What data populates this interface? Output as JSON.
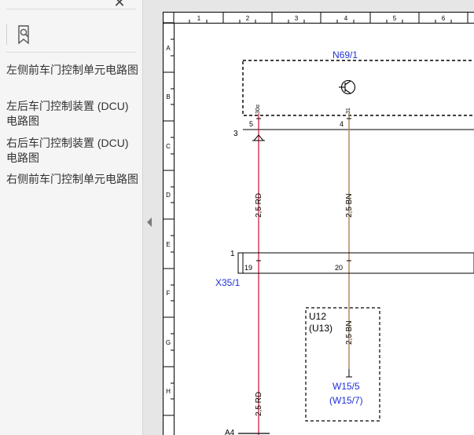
{
  "sidebar": {
    "close_glyph": "✕",
    "bookmark_icon": "bookmark-search-icon",
    "bookmarks": [
      {
        "label": "左侧前车门控制单元电路图"
      },
      {
        "label": "左后车门控制装置 (DCU) 电路图"
      },
      {
        "label": "右后车门控制装置 (DCU) 电路图"
      },
      {
        "label": "右侧前车门控制单元电路图"
      }
    ]
  },
  "diagram": {
    "col_labels": [
      "1",
      "2",
      "3",
      "4",
      "5",
      "6"
    ],
    "row_labels": [
      "A",
      "B",
      "C",
      "D",
      "E",
      "F",
      "G",
      "H"
    ],
    "n69_label": "N69/1",
    "pin_30a": "30α",
    "pin_31": "31",
    "pin_5": "5",
    "pin_4": "4",
    "node_3": "3",
    "node_1": "1",
    "wire_rd_upper": "2,5 RD",
    "wire_bn_upper": "2,5 BN",
    "x35_label": "X35/1",
    "pin_19": "19",
    "pin_20": "20",
    "u12_label": "U12",
    "u13_label": "(U13)",
    "wire_bn_lower": "2,5 BN",
    "w15_label": "W15/5",
    "w157_label": "(W15/7)",
    "wire_rd_lower": "2,5 RD",
    "a4_label": "A4",
    "colors": {
      "red_wire": "#c8102e",
      "brown_wire": "#b5895a",
      "blue_text": "#1f2fd6"
    }
  }
}
